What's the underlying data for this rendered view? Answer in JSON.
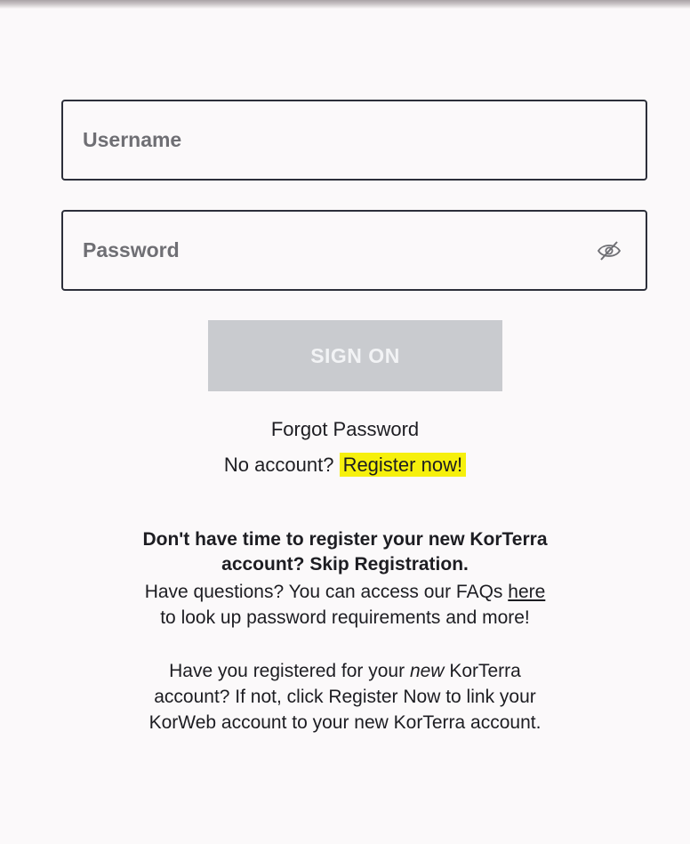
{
  "login": {
    "username_placeholder": "Username",
    "password_placeholder": "Password",
    "sign_on_label": "SIGN ON",
    "forgot_password": "Forgot Password",
    "no_account_text": "No account?",
    "register_now": "Register now!"
  },
  "skip": {
    "line1": "Don't have time to register your new KorTerra",
    "line2_prefix": "account?",
    "skip_link": "Skip Registration."
  },
  "faq": {
    "line1_prefix": "Have questions? You can access our FAQs",
    "here_link": "here",
    "line2": "to look up password requirements and more!"
  },
  "register_info": {
    "line1_prefix": "Have you registered for your",
    "line1_em": "new",
    "line1_suffix": "KorTerra",
    "line2": "account? If not, click Register Now to link your",
    "line3": "KorWeb account to your new KorTerra account."
  },
  "icons": {
    "password_toggle": "eye-slash-icon"
  },
  "colors": {
    "background": "#fbf9fa",
    "border": "#2c2f3a",
    "button_disabled": "#c9cbcf",
    "highlight": "#f6f00c",
    "text": "#1d1d22"
  }
}
